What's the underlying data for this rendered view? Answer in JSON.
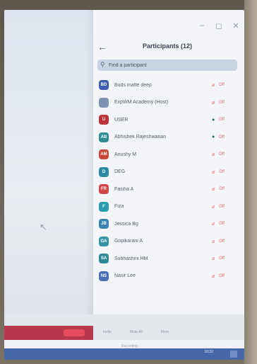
{
  "window": {
    "minimize_icon": "minimize-icon",
    "maximize_icon": "maximize-icon",
    "close_icon": "close-icon"
  },
  "panel": {
    "title": "Participants (12)",
    "back_icon": "arrow-left-icon"
  },
  "search": {
    "placeholder": "Find a participant",
    "icon": "search-icon"
  },
  "participants": [
    {
      "initials": "BD",
      "name": "Buds matte deep",
      "color": "#3f5fb0",
      "mic": "muted"
    },
    {
      "initials": "",
      "name": "ExpWM Academy (Host)",
      "color": "#7f93b5",
      "mic": "muted"
    },
    {
      "initials": "U",
      "name": "USER",
      "color": "#c0313a",
      "mic": "on"
    },
    {
      "initials": "AB",
      "name": "Abhishek Rajeshwarian",
      "color": "#2e8c93",
      "mic": "on"
    },
    {
      "initials": "AM",
      "name": "Anushy M",
      "color": "#c94a3a",
      "mic": "muted"
    },
    {
      "initials": "D",
      "name": "DEG",
      "color": "#2b8ba3",
      "mic": "muted"
    },
    {
      "initials": "FR",
      "name": "Fasiha A",
      "color": "#d24545",
      "mic": "muted"
    },
    {
      "initials": "F",
      "name": "Fiza",
      "color": "#2a9cad",
      "mic": "muted"
    },
    {
      "initials": "JB",
      "name": "Jessica Bg",
      "color": "#3a83b3",
      "mic": "muted"
    },
    {
      "initials": "GA",
      "name": "Gopikarani A",
      "color": "#3596a8",
      "mic": "muted"
    },
    {
      "initials": "SA",
      "name": "Subhashini HM",
      "color": "#2f8a98",
      "mic": "muted"
    },
    {
      "initials": "NS",
      "name": "Nasir Lee",
      "color": "#4a6fb8",
      "mic": "muted"
    }
  ],
  "status_labels": {
    "muted": "Off",
    "on": "Off"
  },
  "footer": {
    "left_button": "",
    "actions": [
      "Invite",
      "Mute All",
      "More"
    ],
    "sub_text": "Recording",
    "time": "10:32"
  }
}
